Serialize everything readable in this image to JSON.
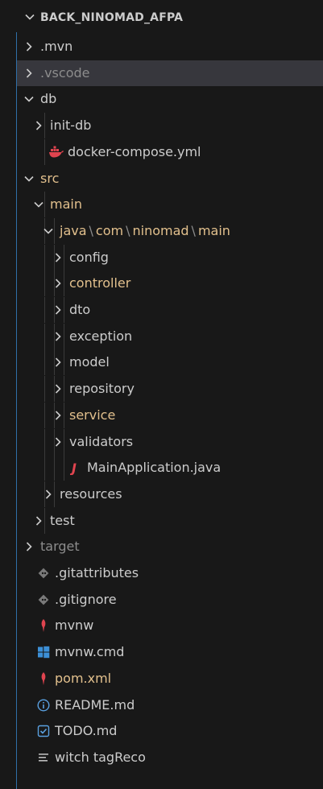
{
  "explorer": {
    "title": "BACK_NINOMAD_AFPA",
    "items": [
      {
        "label": ".mvn",
        "kind": "folder",
        "expanded": false,
        "depth": 0,
        "color": "#cccccc"
      },
      {
        "label": ".vscode",
        "kind": "folder",
        "expanded": false,
        "depth": 0,
        "color": "#8c8c8c",
        "selected": true
      },
      {
        "label": "db",
        "kind": "folder",
        "expanded": true,
        "depth": 0,
        "color": "#cccccc"
      },
      {
        "label": "init-db",
        "kind": "folder",
        "expanded": false,
        "depth": 1,
        "color": "#cccccc"
      },
      {
        "label": "docker-compose.yml",
        "kind": "file",
        "icon": "docker-icon",
        "depth": 1,
        "color": "#cccccc"
      },
      {
        "label": "src",
        "kind": "folder",
        "expanded": true,
        "depth": 0,
        "color": "#e2c08d"
      },
      {
        "label": "main",
        "kind": "folder",
        "expanded": true,
        "depth": 1,
        "color": "#e2c08d"
      },
      {
        "path_parts": [
          "java",
          "com",
          "ninomad",
          "main"
        ],
        "kind": "folder",
        "expanded": true,
        "depth": 2,
        "color": "#e2c08d"
      },
      {
        "label": "config",
        "kind": "folder",
        "expanded": false,
        "depth": 3,
        "color": "#cccccc"
      },
      {
        "label": "controller",
        "kind": "folder",
        "expanded": false,
        "depth": 3,
        "color": "#e2c08d"
      },
      {
        "label": "dto",
        "kind": "folder",
        "expanded": false,
        "depth": 3,
        "color": "#cccccc"
      },
      {
        "label": "exception",
        "kind": "folder",
        "expanded": false,
        "depth": 3,
        "color": "#cccccc"
      },
      {
        "label": "model",
        "kind": "folder",
        "expanded": false,
        "depth": 3,
        "color": "#cccccc"
      },
      {
        "label": "repository",
        "kind": "folder",
        "expanded": false,
        "depth": 3,
        "color": "#cccccc"
      },
      {
        "label": "service",
        "kind": "folder",
        "expanded": false,
        "depth": 3,
        "color": "#e2c08d"
      },
      {
        "label": "validators",
        "kind": "folder",
        "expanded": false,
        "depth": 3,
        "color": "#cccccc"
      },
      {
        "label": "MainApplication.java",
        "kind": "file",
        "icon": "java-icon",
        "depth": 3,
        "color": "#cccccc"
      },
      {
        "label": "resources",
        "kind": "folder",
        "expanded": false,
        "depth": 2,
        "color": "#cccccc"
      },
      {
        "label": "test",
        "kind": "folder",
        "expanded": false,
        "depth": 1,
        "color": "#cccccc"
      },
      {
        "label": "target",
        "kind": "folder",
        "expanded": false,
        "depth": 0,
        "color": "#8c8c8c"
      },
      {
        "label": ".gitattributes",
        "kind": "file",
        "icon": "git-icon",
        "depth": 0,
        "color": "#cccccc"
      },
      {
        "label": ".gitignore",
        "kind": "file",
        "icon": "git-icon",
        "depth": 0,
        "color": "#cccccc"
      },
      {
        "label": "mvnw",
        "kind": "file",
        "icon": "maven-feather-icon",
        "depth": 0,
        "color": "#cccccc"
      },
      {
        "label": "mvnw.cmd",
        "kind": "file",
        "icon": "windows-icon",
        "depth": 0,
        "color": "#cccccc"
      },
      {
        "label": "pom.xml",
        "kind": "file",
        "icon": "maven-feather-icon",
        "depth": 0,
        "color": "#e2c08d"
      },
      {
        "label": "README.md",
        "kind": "file",
        "icon": "info-icon",
        "depth": 0,
        "color": "#cccccc"
      },
      {
        "label": "TODO.md",
        "kind": "file",
        "icon": "checkbox-icon",
        "depth": 0,
        "color": "#cccccc"
      },
      {
        "label": "witch tagReco",
        "kind": "file",
        "icon": "text-lines-icon",
        "depth": 0,
        "color": "#cccccc"
      }
    ]
  },
  "colors": {
    "background": "#181818",
    "selected_row": "#37373d",
    "modified_text": "#e2c08d",
    "ignored_text": "#8c8c8c",
    "docker": "#e0444f",
    "java": "#e0444f",
    "maven": "#e0444f",
    "windows": "#3c8fd6",
    "info": "#5aa0e0",
    "todo": "#5aa0e0",
    "focus_border": "#2f6fa8"
  }
}
